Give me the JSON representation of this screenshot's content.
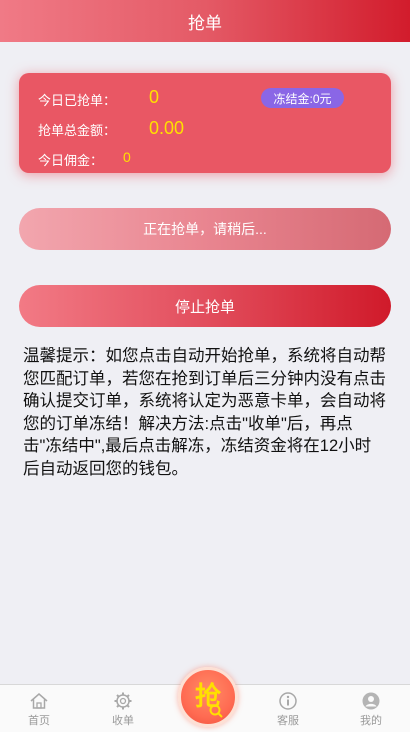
{
  "header": {
    "title": "抢单"
  },
  "stats": {
    "today_grabbed_label": "今日已抢单：",
    "today_grabbed_value": "0",
    "total_amount_label": "抢单总金额：",
    "total_amount_value": "0.00",
    "today_commission_label": "今日佣金：",
    "today_commission_value": "0",
    "frozen_label": "冻结金:0元"
  },
  "grab_status": {
    "label": "正在抢单，请稍后..."
  },
  "stop_button": {
    "label": "停止抢单"
  },
  "tip": {
    "text": "温馨提示：如您点击自动开始抢单，系统将自动帮您匹配订单，若您在抢到订单后三分钟内没有点击确认提交订单，系统将认定为恶意卡单，会自动将您的订单冻结！解决方法:点击\"收单\"后，再点击\"冻结中\",最后点击解冻，冻结资金将在12小时后自动返回您的钱包。"
  },
  "tabbar": {
    "items": [
      {
        "label": "首页",
        "icon": "home-icon"
      },
      {
        "label": "收单",
        "icon": "gear-icon"
      },
      {
        "label": "抢",
        "icon": "grab-icon"
      },
      {
        "label": "客服",
        "icon": "info-icon"
      },
      {
        "label": "我的",
        "icon": "user-icon"
      }
    ]
  },
  "colors": {
    "accent": "#e95764",
    "highlight": "#ffe000",
    "badge": "#8a66e6",
    "background": "#efeff4"
  }
}
